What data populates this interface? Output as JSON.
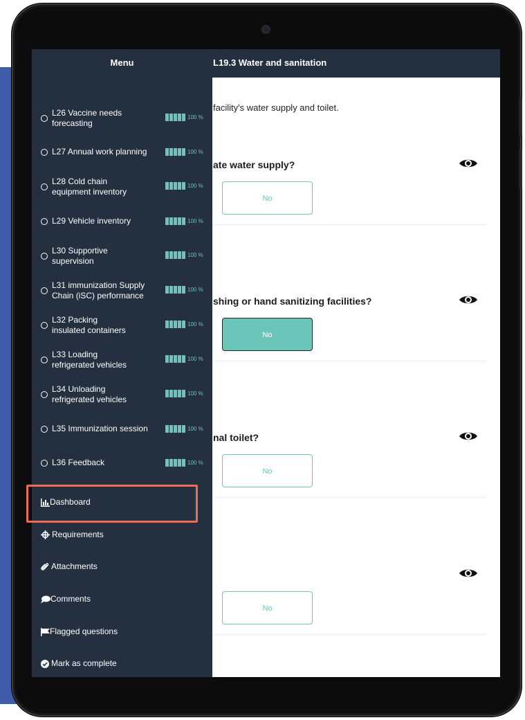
{
  "page_title": "L19.3 Water and sanitation",
  "intro_text": "facility's water supply and toilet.",
  "questions": [
    {
      "text": "ate water supply?",
      "answer": "No",
      "selected": false
    },
    {
      "text": "shing or hand sanitizing facilities?",
      "answer": "No",
      "selected": true
    },
    {
      "text": "nal toilet?",
      "answer": "No",
      "selected": false
    },
    {
      "text": "",
      "answer": "No",
      "selected": false
    }
  ],
  "menu": {
    "title": "Menu",
    "lessons": [
      {
        "line1": "L26 Vaccine needs",
        "line2": "forecasting",
        "pct": "100 %"
      },
      {
        "line1": "L27 Annual work planning",
        "line2": "",
        "pct": "100 %"
      },
      {
        "line1": "L28 Cold chain",
        "line2": "equipment inventory",
        "pct": "100 %"
      },
      {
        "line1": "L29 Vehicle inventory",
        "line2": "",
        "pct": "100 %"
      },
      {
        "line1": "L30 Supportive",
        "line2": "supervision",
        "pct": "100 %"
      },
      {
        "line1": "L31 immunization Supply",
        "line2": "Chain (iSC) performance",
        "pct": "100 %"
      },
      {
        "line1": "L32 Packing",
        "line2": "insulated containers",
        "pct": "100 %"
      },
      {
        "line1": "L33 Loading",
        "line2": "refrigerated vehicles",
        "pct": "100 %"
      },
      {
        "line1": "L34 Unloading",
        "line2": "refrigerated vehicles",
        "pct": "100 %"
      },
      {
        "line1": "L35 Immunization session",
        "line2": "",
        "pct": "100 %"
      },
      {
        "line1": "L36 Feedback",
        "line2": "",
        "pct": "100 %"
      }
    ],
    "actions": {
      "dashboard": "Dashboard",
      "requirements": "Requirements",
      "attachments": "Attachments",
      "comments": "Comments",
      "flagged": "Flagged questions",
      "complete": "Mark as complete"
    }
  },
  "colors": {
    "accent": "#6cc5b9",
    "menu_bg": "#242f40",
    "highlight": "#ef6a52",
    "backdrop": "#3f5cab"
  }
}
